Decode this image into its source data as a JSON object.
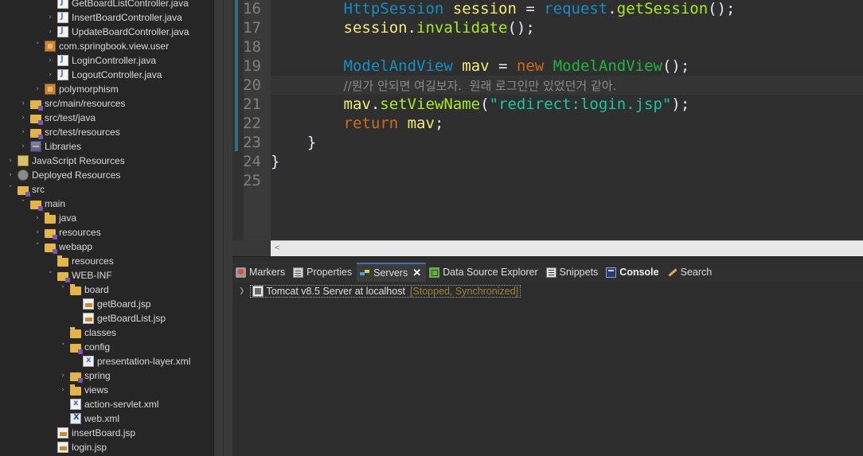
{
  "explorer": {
    "items": [
      {
        "label": "GetBoardListController.java",
        "icon": "java-file-icon",
        "indent": 74,
        "chevron": "none"
      },
      {
        "label": "InsertBoardController.java",
        "icon": "java-file-icon",
        "indent": 74,
        "chevron": "collapsed"
      },
      {
        "label": "UpdateBoardController.java",
        "icon": "java-file-icon",
        "indent": 74,
        "chevron": "collapsed"
      },
      {
        "label": "com.springbook.view.user",
        "icon": "package-icon",
        "indent": 58,
        "chevron": "expanded"
      },
      {
        "label": "LoginController.java",
        "icon": "java-file-icon",
        "indent": 74,
        "chevron": "collapsed"
      },
      {
        "label": "LogoutController.java",
        "icon": "java-file-icon",
        "indent": 74,
        "chevron": "collapsed"
      },
      {
        "label": "polymorphism",
        "icon": "package-icon",
        "indent": 58,
        "chevron": "collapsed"
      },
      {
        "label": "src/main/resources",
        "icon": "source-folder-icon",
        "indent": 40,
        "chevron": "collapsed"
      },
      {
        "label": "src/test/java",
        "icon": "source-folder-icon",
        "indent": 40,
        "chevron": "collapsed"
      },
      {
        "label": "src/test/resources",
        "icon": "source-folder-icon",
        "indent": 40,
        "chevron": "collapsed"
      },
      {
        "label": "Libraries",
        "icon": "library-icon",
        "indent": 40,
        "chevron": "collapsed"
      },
      {
        "label": "JavaScript Resources",
        "icon": "javascript-resources-icon",
        "indent": 24,
        "chevron": "collapsed"
      },
      {
        "label": "Deployed Resources",
        "icon": "deployed-resources-icon",
        "indent": 24,
        "chevron": "collapsed"
      },
      {
        "label": "src",
        "icon": "source-folder-icon",
        "indent": 24,
        "chevron": "expanded"
      },
      {
        "label": "main",
        "icon": "source-folder-icon",
        "indent": 40,
        "chevron": "expanded"
      },
      {
        "label": "java",
        "icon": "folder-icon",
        "indent": 58,
        "chevron": "collapsed"
      },
      {
        "label": "resources",
        "icon": "source-folder-icon",
        "indent": 58,
        "chevron": "collapsed"
      },
      {
        "label": "webapp",
        "icon": "source-folder-icon",
        "indent": 58,
        "chevron": "expanded"
      },
      {
        "label": "resources",
        "icon": "folder-icon",
        "indent": 74,
        "chevron": "none"
      },
      {
        "label": "WEB-INF",
        "icon": "source-folder-icon",
        "indent": 74,
        "chevron": "expanded"
      },
      {
        "label": "board",
        "icon": "folder-icon",
        "indent": 90,
        "chevron": "expanded"
      },
      {
        "label": "getBoard.jsp",
        "icon": "jsp-file-icon",
        "indent": 106,
        "chevron": "none"
      },
      {
        "label": "getBoardList.jsp",
        "icon": "jsp-file-icon",
        "indent": 106,
        "chevron": "none"
      },
      {
        "label": "classes",
        "icon": "folder-icon",
        "indent": 90,
        "chevron": "none"
      },
      {
        "label": "config",
        "icon": "source-folder-icon",
        "indent": 90,
        "chevron": "expanded"
      },
      {
        "label": "presentation-layer.xml",
        "icon": "xml-file-icon",
        "indent": 106,
        "chevron": "none"
      },
      {
        "label": "spring",
        "icon": "source-folder-icon",
        "indent": 90,
        "chevron": "collapsed"
      },
      {
        "label": "views",
        "icon": "folder-icon",
        "indent": 90,
        "chevron": "collapsed"
      },
      {
        "label": "action-servlet.xml",
        "icon": "xml-file-icon",
        "indent": 90,
        "chevron": "none"
      },
      {
        "label": "web.xml",
        "icon": "web-xml-icon",
        "indent": 90,
        "chevron": "none"
      },
      {
        "label": "insertBoard.jsp",
        "icon": "jsp-file-icon",
        "indent": 74,
        "chevron": "none"
      },
      {
        "label": "login.jsp",
        "icon": "jsp-file-icon",
        "indent": 74,
        "chevron": "none"
      }
    ]
  },
  "editor": {
    "line_numbers": [
      "16",
      "17",
      "18",
      "19",
      "20",
      "21",
      "22",
      "23",
      "24",
      "25"
    ],
    "current_line_index": 4,
    "lines": [
      [
        {
          "t": "        ",
          "c": "punc"
        },
        {
          "t": "HttpSession",
          "c": "type"
        },
        {
          "t": " ",
          "c": "punc"
        },
        {
          "t": "session",
          "c": "var"
        },
        {
          "t": " = ",
          "c": "punc"
        },
        {
          "t": "request",
          "c": "type"
        },
        {
          "t": ".",
          "c": "punc"
        },
        {
          "t": "getSession",
          "c": "meth"
        },
        {
          "t": "();",
          "c": "punc"
        }
      ],
      [
        {
          "t": "        ",
          "c": "punc"
        },
        {
          "t": "session",
          "c": "var"
        },
        {
          "t": ".",
          "c": "punc"
        },
        {
          "t": "invalidate",
          "c": "meth"
        },
        {
          "t": "();",
          "c": "punc"
        }
      ],
      [],
      [
        {
          "t": "        ",
          "c": "punc"
        },
        {
          "t": "ModelAndView",
          "c": "type"
        },
        {
          "t": " ",
          "c": "punc"
        },
        {
          "t": "mav",
          "c": "var"
        },
        {
          "t": " = ",
          "c": "punc"
        },
        {
          "t": "new",
          "c": "kw"
        },
        {
          "t": " ",
          "c": "punc"
        },
        {
          "t": "ModelAndView",
          "c": "cls"
        },
        {
          "t": "();",
          "c": "punc"
        }
      ],
      [
        {
          "t": "        ",
          "c": "punc"
        },
        {
          "t": "//뭔가 안되면 여길보자.  원래 로그인만 있었던거 같아.",
          "c": "cmt"
        }
      ],
      [
        {
          "t": "        ",
          "c": "punc"
        },
        {
          "t": "mav",
          "c": "var"
        },
        {
          "t": ".",
          "c": "punc"
        },
        {
          "t": "setViewName",
          "c": "meth"
        },
        {
          "t": "(",
          "c": "punc"
        },
        {
          "t": "\"redirect:login.jsp\"",
          "c": "str"
        },
        {
          "t": ");",
          "c": "punc"
        }
      ],
      [
        {
          "t": "        ",
          "c": "punc"
        },
        {
          "t": "return",
          "c": "kw"
        },
        {
          "t": " ",
          "c": "punc"
        },
        {
          "t": "mav",
          "c": "var"
        },
        {
          "t": ";",
          "c": "punc"
        }
      ],
      [
        {
          "t": "    }",
          "c": "punc"
        }
      ],
      [
        {
          "t": "}",
          "c": "punc"
        }
      ],
      []
    ],
    "scroll_left_arrow": "<"
  },
  "panel": {
    "tabs": [
      {
        "label": "Markers",
        "icon": "markers-icon",
        "active": false,
        "bold": false
      },
      {
        "label": "Properties",
        "icon": "properties-icon",
        "active": false,
        "bold": false
      },
      {
        "label": "Servers",
        "icon": "servers-icon",
        "active": true,
        "bold": false,
        "close": "✕"
      },
      {
        "label": "Data Source Explorer",
        "icon": "data-source-explorer-icon",
        "active": false,
        "bold": false
      },
      {
        "label": "Snippets",
        "icon": "snippets-icon",
        "active": false,
        "bold": false
      },
      {
        "label": "Console",
        "icon": "console-icon",
        "active": false,
        "bold": true
      },
      {
        "label": "Search",
        "icon": "search-icon",
        "active": false,
        "bold": false
      }
    ],
    "server": {
      "name": "Tomcat v8.5 Server at localhost",
      "status": "[Stopped, Synchronized]"
    }
  },
  "colors": {
    "keyword": "#cc6c1d",
    "type": "#1290c3",
    "variable": "#f3ec79",
    "method": "#a7ec21",
    "string": "#17c6a3",
    "comment": "#8a8a8a"
  }
}
